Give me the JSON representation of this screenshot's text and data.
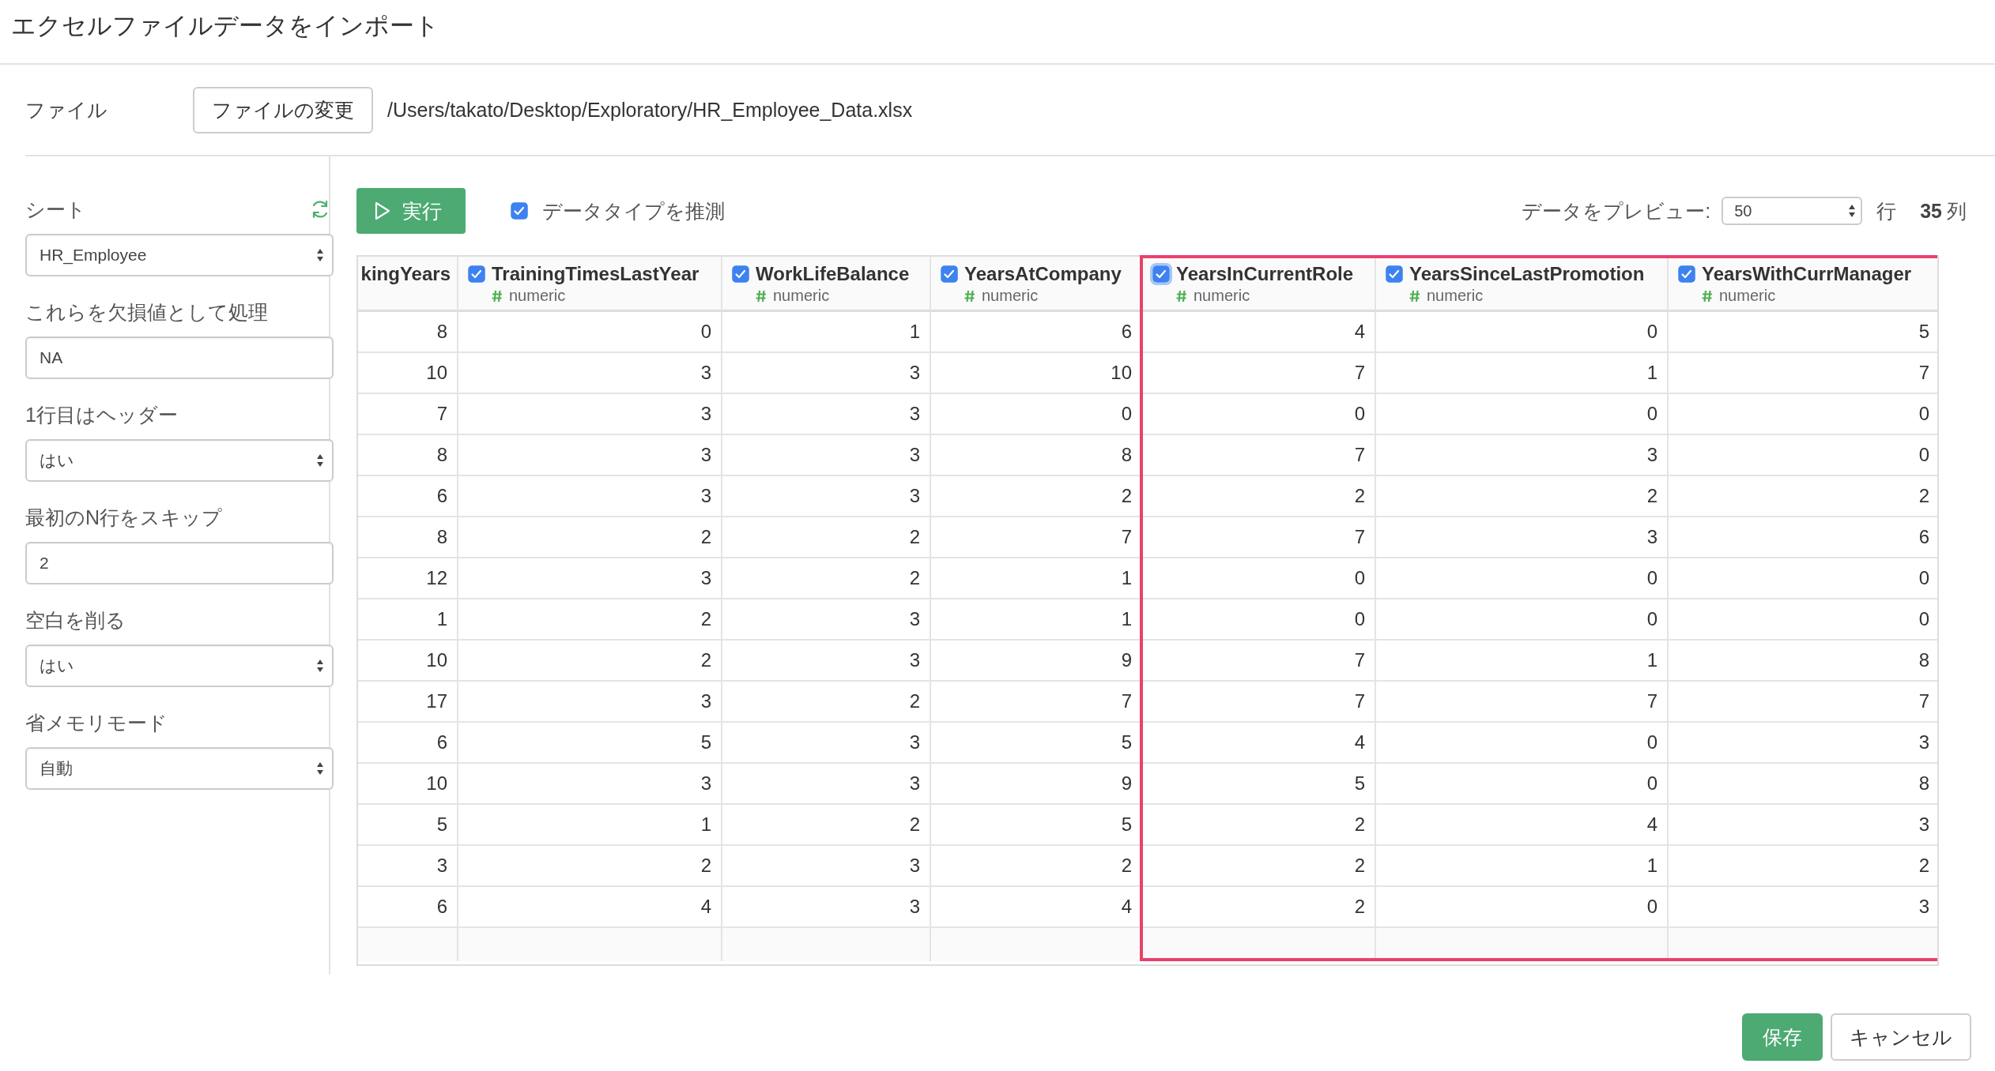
{
  "window": {
    "title": "エクセルファイルデータをインポート"
  },
  "file": {
    "label": "ファイル",
    "button": "ファイルの変更",
    "path": "/Users/takato/Desktop/Exploratory/HR_Employee_Data.xlsx"
  },
  "sidebar": {
    "fields": [
      {
        "kind": "select",
        "label": "シート",
        "value": "HR_Employee",
        "refresh": true
      },
      {
        "kind": "input",
        "label": "これらを欠損値として処理",
        "value": "NA"
      },
      {
        "kind": "select",
        "label": "1行目はヘッダー",
        "value": "はい"
      },
      {
        "kind": "input",
        "label": "最初のN行をスキップ",
        "value": "2"
      },
      {
        "kind": "select",
        "label": "空白を削る",
        "value": "はい"
      },
      {
        "kind": "select",
        "label": "省メモリモード",
        "value": "自動"
      }
    ]
  },
  "toolbar": {
    "run_button": "実行",
    "guess_types": {
      "label": "データタイプを推測",
      "checked": true
    },
    "preview_label": "データをプレビュー:",
    "preview_rows": "50",
    "rows_unit": "行",
    "column_count": "35",
    "columns_unit": "列"
  },
  "table": {
    "columns": [
      {
        "kind": "partial",
        "name": "kingYears",
        "highlighted": false
      },
      {
        "kind": "field",
        "name": "TrainingTimesLastYear",
        "type": "numeric",
        "checked": true,
        "focused": false,
        "highlighted": false
      },
      {
        "kind": "field",
        "name": "WorkLifeBalance",
        "type": "numeric",
        "checked": true,
        "focused": false,
        "highlighted": false
      },
      {
        "kind": "field",
        "name": "YearsAtCompany",
        "type": "numeric",
        "checked": true,
        "focused": false,
        "highlighted": false
      },
      {
        "kind": "field",
        "name": "YearsInCurrentRole",
        "type": "numeric",
        "checked": true,
        "focused": true,
        "highlighted": true
      },
      {
        "kind": "field",
        "name": "YearsSinceLastPromotion",
        "type": "numeric",
        "checked": true,
        "focused": false,
        "highlighted": true
      },
      {
        "kind": "field",
        "name": "YearsWithCurrManager",
        "type": "numeric",
        "checked": true,
        "focused": false,
        "highlighted": true
      }
    ],
    "rows": [
      [
        "8",
        "0",
        "1",
        "6",
        "4",
        "0",
        "5"
      ],
      [
        "10",
        "3",
        "3",
        "10",
        "7",
        "1",
        "7"
      ],
      [
        "7",
        "3",
        "3",
        "0",
        "0",
        "0",
        "0"
      ],
      [
        "8",
        "3",
        "3",
        "8",
        "7",
        "3",
        "0"
      ],
      [
        "6",
        "3",
        "3",
        "2",
        "2",
        "2",
        "2"
      ],
      [
        "8",
        "2",
        "2",
        "7",
        "7",
        "3",
        "6"
      ],
      [
        "12",
        "3",
        "2",
        "1",
        "0",
        "0",
        "0"
      ],
      [
        "1",
        "2",
        "3",
        "1",
        "0",
        "0",
        "0"
      ],
      [
        "10",
        "2",
        "3",
        "9",
        "7",
        "1",
        "8"
      ],
      [
        "17",
        "3",
        "2",
        "7",
        "7",
        "7",
        "7"
      ],
      [
        "6",
        "5",
        "3",
        "5",
        "4",
        "0",
        "3"
      ],
      [
        "10",
        "3",
        "3",
        "9",
        "5",
        "0",
        "8"
      ],
      [
        "5",
        "1",
        "2",
        "5",
        "2",
        "4",
        "3"
      ],
      [
        "3",
        "2",
        "3",
        "2",
        "2",
        "1",
        "2"
      ],
      [
        "6",
        "4",
        "3",
        "4",
        "2",
        "0",
        "3"
      ]
    ]
  },
  "footer": {
    "save_button": "保存",
    "cancel_button": "キャンセル"
  }
}
